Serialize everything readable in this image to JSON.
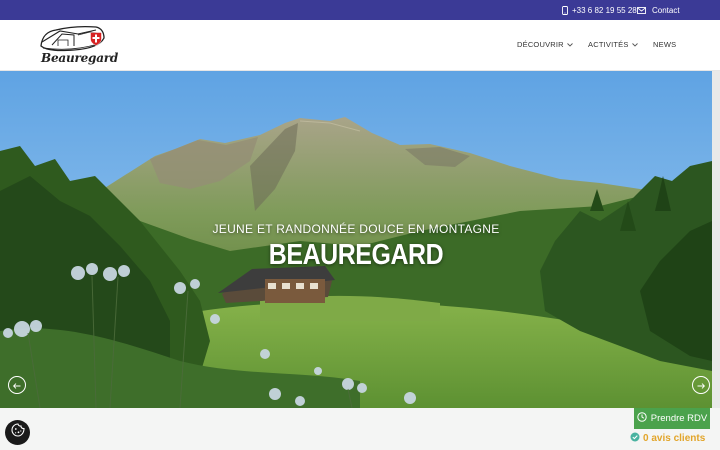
{
  "topbar": {
    "phone": "+33 6 82 19 55 28",
    "contact_label": "Contact",
    "background": "#3b3a96"
  },
  "header": {
    "logo_text": "Beauregard",
    "nav": [
      {
        "label": "DÉCOUVRIR",
        "has_dropdown": true
      },
      {
        "label": "ACTIVITÉS",
        "has_dropdown": true
      },
      {
        "label": "NEWS",
        "has_dropdown": false
      }
    ]
  },
  "hero": {
    "subtitle": "JEUNE ET RANDONNÉE DOUCE EN MONTAGNE",
    "title": "BEAUREGARD",
    "prev_icon": "arrow-left-icon",
    "next_icon": "arrow-right-icon"
  },
  "widgets": {
    "appointment_label": "Prendre RDV",
    "reviews_label": "0 avis clients",
    "appointment_color": "#4ba24c",
    "reviews_color": "#e2a52a",
    "cookie_icon": "cookie-icon"
  }
}
